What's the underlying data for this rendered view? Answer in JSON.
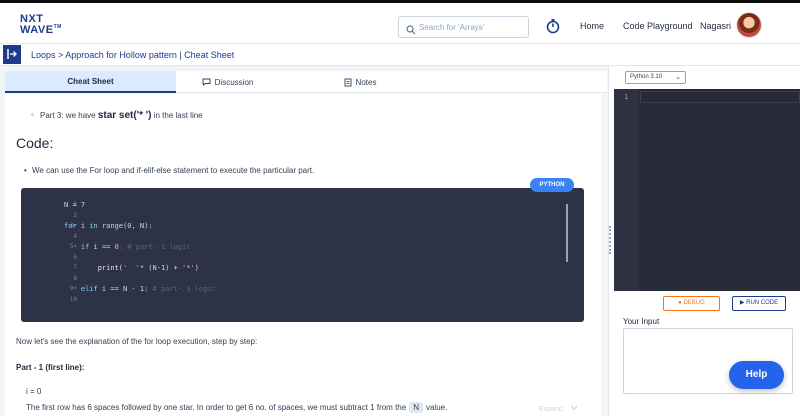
{
  "logo": {
    "line1": "NXT",
    "line2": "WAVE",
    "tm": "TM"
  },
  "search": {
    "placeholder": "Search for 'Arrays'"
  },
  "nav": {
    "home": "Home",
    "playground": "Code Playground",
    "user": "Nagasri"
  },
  "breadcrumb": "Loops > Approach for Hollow pattern | Cheat Sheet",
  "tabs": [
    {
      "label": "Cheat Sheet",
      "icon": ""
    },
    {
      "label": "Discussion",
      "icon": "chat-icon"
    },
    {
      "label": "Notes",
      "icon": "notes-icon"
    }
  ],
  "content": {
    "part3_prefix": "Part 3: we have ",
    "part3_bold": "star set('* ')",
    "part3_suffix": " in the last line",
    "code_heading": "Code:",
    "for_text": "We can use the For loop and if-elif-else statement to execute the particular part.",
    "lang_badge": "PYTHON",
    "expand_label": "Expand",
    "explain": "Now let's see the explanation of the for loop execution, step by step:",
    "part1_heading": "Part - 1 (first line):",
    "i0": "i = 0",
    "firstrow_prefix": "The first row has 6 spaces followed by one star. In order to get 6 no. of spaces, we must subtract 1 from the",
    "firstrow_badge": "N",
    "firstrow_suffix": "value."
  },
  "code_lines": [
    "1",
    "2",
    "3",
    "4",
    "5",
    "6",
    "7",
    "8",
    "9",
    "10"
  ],
  "code": {
    "l1": "N = 7",
    "l3a": "for",
    "l3b": " i ",
    "l3c": "in",
    "l3d": " range(0, N):",
    "l5a": "if",
    "l5b": " i == ",
    "l5c": "0",
    "l5d": ": # part- 1 logic",
    "l7a": "print(",
    "l7b": "'  '",
    "l7c": "* (N-1) + ",
    "l7d": "'*'",
    "l7e": ")",
    "l9a": "elif",
    "l9b": " i == N - 1: ",
    "l9c": "# part- 3 logic"
  },
  "editor": {
    "language": "Python 3.10",
    "line1": "1"
  },
  "buttons": {
    "debug": "DEBUG",
    "run": "RUN CODE",
    "help": "Help"
  },
  "input": {
    "label": "Your Input"
  },
  "colors": {
    "brand": "#1e3a8a",
    "accent": "#3b82f6",
    "debug": "#f97316",
    "editor_bg": "#272a38"
  }
}
